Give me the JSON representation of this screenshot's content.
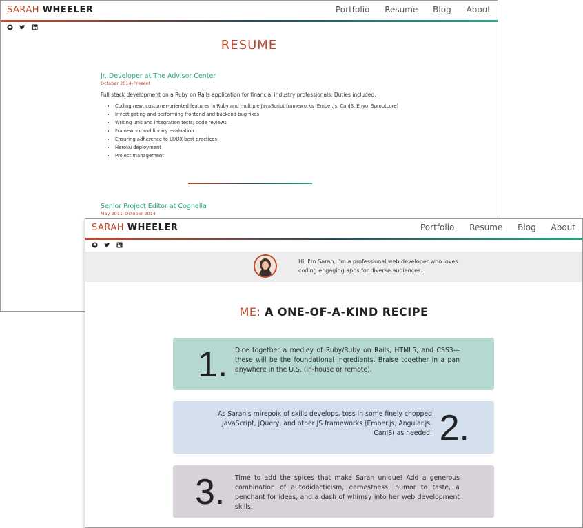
{
  "site": {
    "brand_first": "SARAH",
    "brand_last": "WHEELER",
    "nav": [
      "Portfolio",
      "Resume",
      "Blog",
      "About"
    ],
    "social_icons": [
      "github-icon",
      "twitter-icon",
      "linkedin-icon"
    ]
  },
  "colors": {
    "accent": "#c0492b",
    "teal": "#2aa384",
    "dark": "#2f4a56",
    "card_1": "#b5d8d1",
    "card_2": "#d3dfec",
    "card_3": "#d8d1d9"
  },
  "resume": {
    "title": "RESUME",
    "jobs": [
      {
        "title": "Jr. Developer at The Advisor Center",
        "dates": "October 2014–Present",
        "description": "Full stack development on a Ruby on Rails application for financial industry professionals. Duties included:",
        "duties": [
          "Coding new, customer-oriented features in Ruby and multiple JavaScript frameworks (Ember.js, CanJS, Enyo, Sproutcore)",
          "Investigating and performing frontend and backend bug fixes",
          "Writing unit and integration tests; code reviews",
          "Framework and library evaluation",
          "Ensuring adherence to UI/UX best practices",
          "Heroku deployment",
          "Project management"
        ]
      },
      {
        "title": "Senior Project Editor at Cognella",
        "dates": "May 2011–October 2014"
      }
    ]
  },
  "home": {
    "bio": "Hi, I'm Sarah. I'm a professional web developer who loves coding engaging apps for diverse audiences.",
    "headline_me": "ME:",
    "headline_rest": "A ONE-OF-A-KIND RECIPE",
    "steps": [
      {
        "number": "1.",
        "text": "Dice together a medley of Ruby/Ruby on Rails, HTML5, and CSS3—these will be the foundational ingredients. Braise together in a pan anywhere in the U.S. (in-house or remote)."
      },
      {
        "number": "2.",
        "text": "As Sarah's mirepoix of skills develops, toss in some finely chopped JavaScript, jQuery, and other JS frameworks (Ember.js, Angular.js, CanJS) as needed."
      },
      {
        "number": "3.",
        "text": "Time to add the spices that make Sarah unique! Add a generous combination of autodidacticism, earnestness, humor to taste, a penchant for ideas, and a dash of whimsy into her web development skills."
      }
    ]
  }
}
